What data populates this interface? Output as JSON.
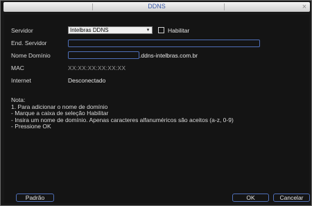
{
  "window": {
    "title": "DDNS",
    "close_glyph": "×"
  },
  "form": {
    "servidor": {
      "label": "Servidor",
      "value": "Intelbras DDNS",
      "arrow": "▾"
    },
    "habilitar": {
      "label": "Habilitar",
      "checked": false
    },
    "end_servidor": {
      "label": "End. Servidor",
      "value": ""
    },
    "nome_dominio": {
      "label": "Nome Domínio",
      "value": "",
      "suffix": ".ddns-intelbras.com.br"
    },
    "mac": {
      "label": "MAC",
      "value": "XX:XX:XX:XX:XX:XX"
    },
    "internet": {
      "label": "Internet",
      "value": "Desconectado"
    }
  },
  "note": {
    "heading": "Nota:",
    "lines": [
      "1. Para adicionar o nome de domínio",
      " - Marque a caixa de seleção Habilitar",
      " - Insira um nome de domínio. Apenas caracteres alfanuméricos são aceitos (a-z, 0-9)",
      " - Pressione OK"
    ]
  },
  "buttons": {
    "default": "Padrão",
    "ok": "OK",
    "cancel": "Cancelar"
  }
}
